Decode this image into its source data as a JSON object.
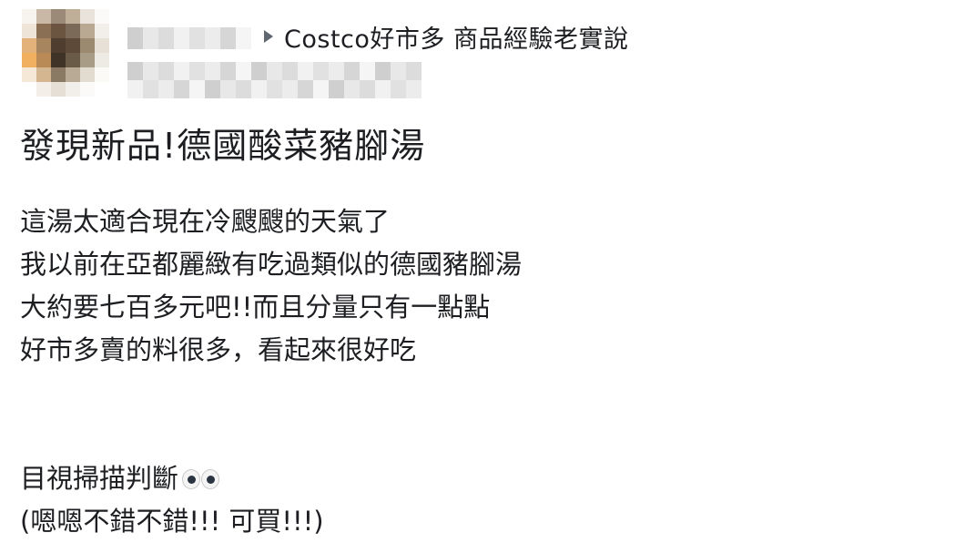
{
  "post": {
    "group_name": "Costco好市多 商品經驗老實說",
    "title": "發現新品!德國酸菜豬腳湯",
    "body_lines": [
      "這湯太適合現在冷颼颼的天氣了",
      "我以前在亞都麗緻有吃過類似的德國豬腳湯",
      "大約要七百多元吧!!而且分量只有一點點",
      "好市多賣的料很多，看起來很好吃",
      "",
      "目視掃描判斷",
      "(嗯嗯不錯不錯!!! 可買!!!)"
    ]
  },
  "icons": {
    "group_arrow": "caret-right-icon",
    "eyes": "eyes-emoji-icon"
  },
  "colors": {
    "text": "#1c1e21",
    "secondary": "#606770",
    "background": "#ffffff"
  }
}
